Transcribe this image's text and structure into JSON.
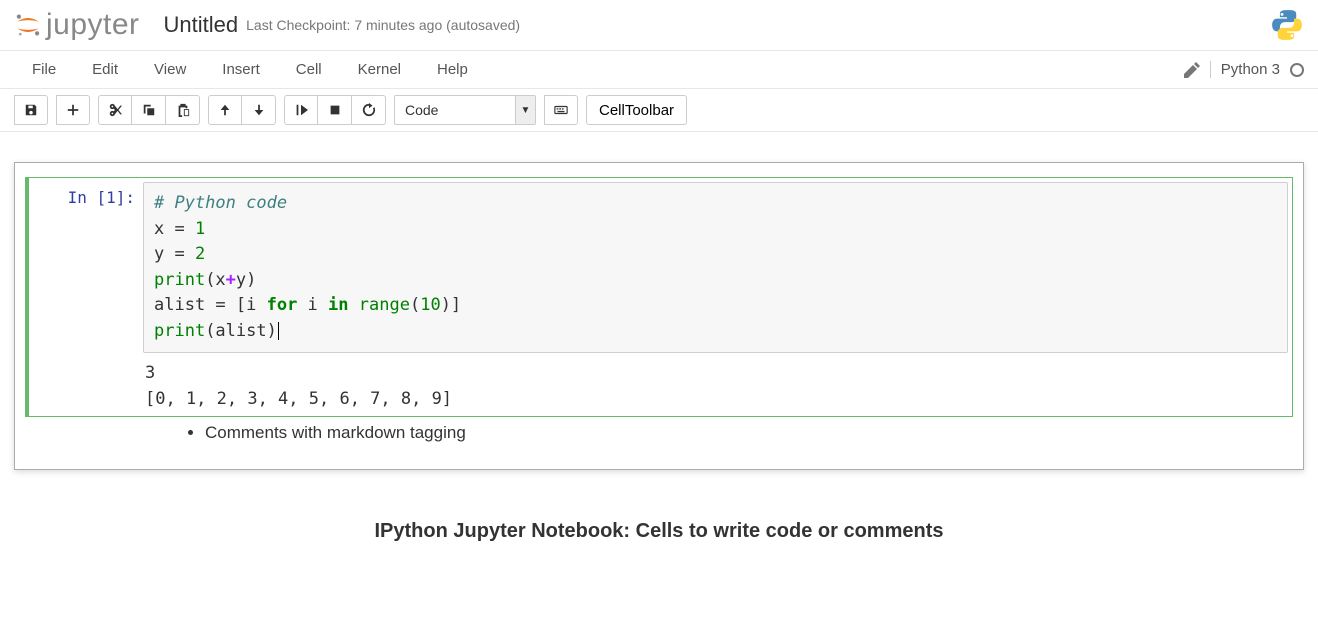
{
  "header": {
    "logo_text": "jupyter",
    "title": "Untitled",
    "checkpoint": "Last Checkpoint: 7 minutes ago (autosaved)"
  },
  "menubar": {
    "items": [
      "File",
      "Edit",
      "View",
      "Insert",
      "Cell",
      "Kernel",
      "Help"
    ],
    "kernel_name": "Python 3"
  },
  "toolbar": {
    "cell_type_selected": "Code",
    "celltoolbar_label": "CellToolbar"
  },
  "cells": [
    {
      "prompt": "In [1]:",
      "code": {
        "line1_comment": "# Python code",
        "line2_var": "x = ",
        "line2_num": "1",
        "line3_var": "y = ",
        "line3_num": "2",
        "line4_pre": "print",
        "line4_open": "(x",
        "line4_op": "+",
        "line4_close": "y)",
        "line5_a": "alist = [i ",
        "line5_for": "for",
        "line5_b": " i ",
        "line5_in": "in",
        "line5_c": " ",
        "line5_range": "range",
        "line5_d": "(",
        "line5_num": "10",
        "line5_e": ")]",
        "line6_pre": "print",
        "line6_rest": "(alist)"
      },
      "output_line1": "3",
      "output_line2": "[0, 1, 2, 3, 4, 5, 6, 7, 8, 9]"
    },
    {
      "markdown_text": "Comments with markdown tagging"
    }
  ],
  "caption": "IPython Jupyter Notebook: Cells to write code or comments"
}
